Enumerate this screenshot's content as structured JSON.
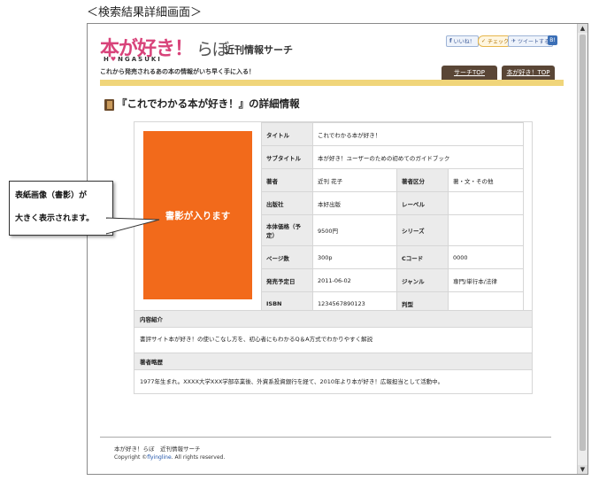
{
  "caption": "＜検索結果詳細画面＞",
  "site": {
    "logo_text": "本が好き！",
    "logo_la": "らぼ",
    "logo_roman_a": "H",
    "logo_roman_heart": "♥",
    "logo_roman_b": "NGASUKI",
    "subtitle": "近刊情報サーチ",
    "tagline": "これから発売されるあの本の情報がいち早く手に入る！"
  },
  "social": {
    "like": "いいね！",
    "check": "チェック",
    "tweet": "ツイートする",
    "badge": "B!"
  },
  "nav": {
    "search_top": "サーチTOP",
    "home_top": "本が好き！TOP"
  },
  "heading": "『これでわかる本が好き！』の詳細情報",
  "cover_placeholder": "書影が入ります",
  "details": {
    "title_label": "タイトル",
    "title_value": "これでわかる本が好き！",
    "subtitle_label": "サブタイトル",
    "subtitle_value": "本が好き！ユーザーのための初めてのガイドブック",
    "author_label": "著者",
    "author_value": "近刊 花子",
    "author_type_label": "著者区分",
    "author_type_value": "著・文・その他",
    "publisher_label": "出版社",
    "publisher_value": "本好出版",
    "level_label": "レーベル",
    "level_value": "",
    "price_label": "本体価格（予定）",
    "price_value": "9500円",
    "series_label": "シリーズ",
    "series_value": "",
    "pages_label": "ページ数",
    "pages_value": "300p",
    "ccode_label": "Cコード",
    "ccode_value": "0000",
    "release_label": "発売予定日",
    "release_value": "2011-06-02",
    "genre_label": "ジャンル",
    "genre_value": "専門/単行本/法律",
    "isbn_label": "ISBN",
    "isbn_value": "1234567890123",
    "format_label": "判型",
    "format_value": ""
  },
  "intro": {
    "heading": "内容紹介",
    "body": "書評サイト本が好き！の使いこなし方を、初心者にもわかるQ＆A方式でわかりやすく解説"
  },
  "profile": {
    "heading": "著者略歴",
    "body": "1977年生まれ。XXXX大学XXX学部卒業後、外資系投資銀行を経て、2010年より本が好き！広報担当として活動中。"
  },
  "footer": {
    "line1": "本が好き！らぼ　近刊情報サーチ",
    "copyright_prefix": "Copyright ©",
    "copyright_link": "flyingline",
    "copyright_suffix": ". All rights reserved."
  },
  "callout": {
    "line1": "表紙画像（書影）が",
    "line2": "大きく表示されます。"
  }
}
